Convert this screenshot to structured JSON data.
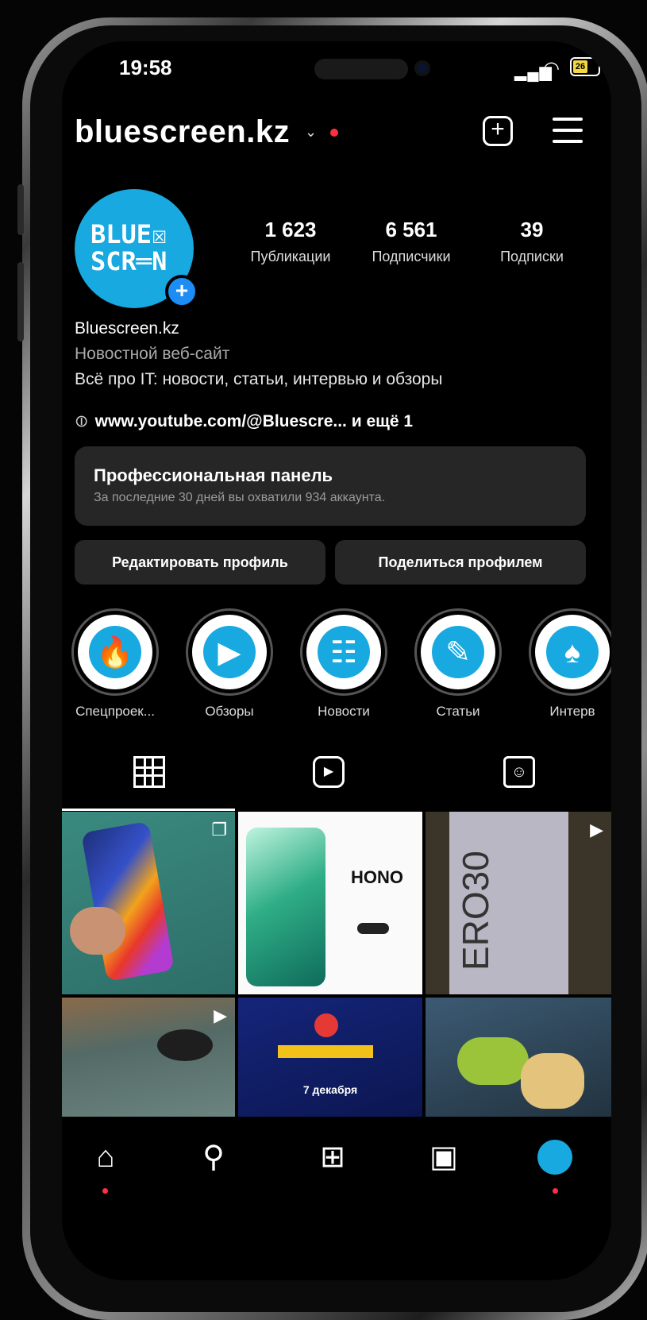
{
  "status_bar": {
    "time": "19:58",
    "battery": "26"
  },
  "header": {
    "username": "bluescreen.kz"
  },
  "profile": {
    "avatar_text_line1": "BLUE☒",
    "avatar_text_line2": "SCR═N",
    "stats": [
      {
        "value": "1 623",
        "label": "Публикации"
      },
      {
        "value": "6 561",
        "label": "Подписчики"
      },
      {
        "value": "39",
        "label": "Подписки"
      }
    ],
    "display_name": "Bluescreen.kz",
    "category": "Новостной веб-сайт",
    "description": "Всё про IT: новости, статьи, интервью и обзоры",
    "link_text": "www.youtube.com/@Bluescre...  и ещё 1"
  },
  "pro_panel": {
    "title": "Профессиональная панель",
    "subtitle": "За последние 30 дней вы охватили 934 аккаунта."
  },
  "buttons": {
    "edit_profile": "Редактировать профиль",
    "share_profile": "Поделиться профилем"
  },
  "highlights": [
    {
      "label": "Спецпроек...",
      "icon": "fire-icon",
      "glyph": "🔥"
    },
    {
      "label": "Обзоры",
      "icon": "video-camera-icon",
      "glyph": "▶"
    },
    {
      "label": "Новости",
      "icon": "newspaper-icon",
      "glyph": "☷"
    },
    {
      "label": "Статьи",
      "icon": "pencil-icon",
      "glyph": "✎"
    },
    {
      "label": "Интерв",
      "icon": "microphone-icon",
      "glyph": "♠"
    }
  ],
  "posts": {
    "post2_title": "HONO",
    "post3_title": "ERO30",
    "post5_title": "7 декабря"
  },
  "colors": {
    "accent": "#17a9e0",
    "notification": "#ff3040",
    "panel": "#262626"
  }
}
